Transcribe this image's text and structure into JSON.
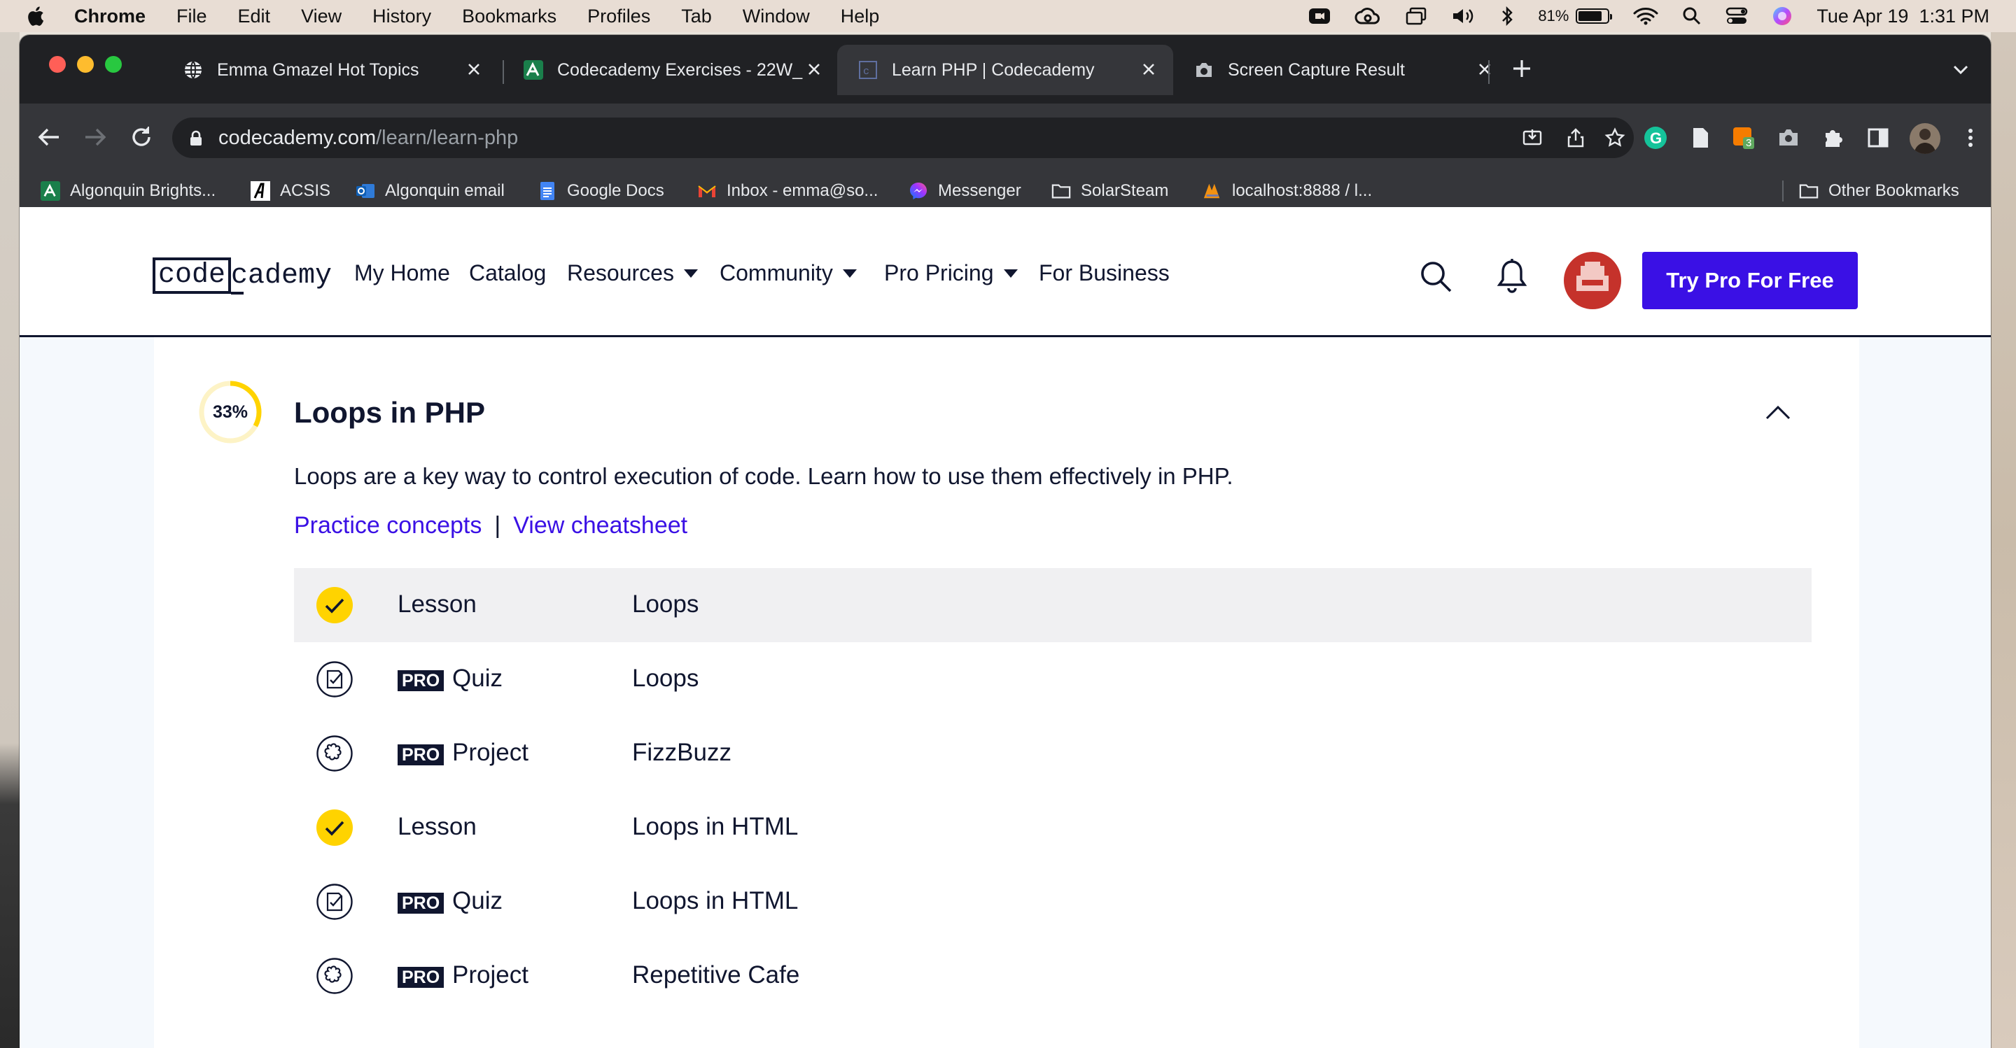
{
  "menubar": {
    "app_name": "Chrome",
    "items": [
      "File",
      "Edit",
      "View",
      "History",
      "Bookmarks",
      "Profiles",
      "Tab",
      "Window",
      "Help"
    ],
    "battery_percent": "81%",
    "battery_level": 0.81,
    "datetime": "Tue Apr 19  1:31 PM"
  },
  "tabs": [
    {
      "title": "Emma Gmazel Hot Topics",
      "icon": "globe-icon",
      "active": false
    },
    {
      "title": "Codecademy Exercises - 22W_",
      "icon": "algonquin-icon",
      "active": false
    },
    {
      "title": "Learn PHP | Codecademy",
      "icon": "codecademy-icon",
      "active": true
    },
    {
      "title": "Screen Capture Result",
      "icon": "camera-icon",
      "active": false
    }
  ],
  "address_bar": {
    "domain": "codecademy.com",
    "path": "/learn/learn-php"
  },
  "bookmarks": [
    {
      "label": "Algonquin Brights...",
      "icon": "algonquin-icon"
    },
    {
      "label": "ACSIS",
      "icon": "acsis-icon"
    },
    {
      "label": "Algonquin email",
      "icon": "outlook-icon"
    },
    {
      "label": "Google Docs",
      "icon": "docs-icon"
    },
    {
      "label": "Inbox - emma@so...",
      "icon": "gmail-icon"
    },
    {
      "label": "Messenger",
      "icon": "messenger-icon"
    },
    {
      "label": "SolarSteam",
      "icon": "folder-icon"
    },
    {
      "label": "localhost:8888 / l...",
      "icon": "phpmyadmin-icon"
    }
  ],
  "other_bookmarks": "Other Bookmarks",
  "extension_badge": "3",
  "site": {
    "logo_boxed": "code",
    "logo_rest": "cademy",
    "nav": [
      {
        "label": "My Home",
        "dropdown": false
      },
      {
        "label": "Catalog",
        "dropdown": false
      },
      {
        "label": "Resources",
        "dropdown": true
      },
      {
        "label": "Community",
        "dropdown": true
      },
      {
        "label": "Pro Pricing",
        "dropdown": true
      },
      {
        "label": "For Business",
        "dropdown": false
      }
    ],
    "cta": "Try Pro For Free",
    "accent_color": "#3a10e5",
    "navy_color": "#10162f",
    "check_color": "#ffd300"
  },
  "section": {
    "progress_label": "33%",
    "progress_fraction": 0.33,
    "title": "Loops in PHP",
    "description": "Loops are a key way to control execution of code. Learn how to use them effectively in PHP.",
    "link_practice": "Practice concepts",
    "link_separator": "|",
    "link_cheatsheet": "View cheatsheet",
    "pro_badge": "PRO",
    "items": [
      {
        "kind": "Lesson",
        "name": "Loops",
        "pro": false,
        "completed": true,
        "icon": "check-icon"
      },
      {
        "kind": "Quiz",
        "name": "Loops",
        "pro": true,
        "completed": false,
        "icon": "quiz-icon"
      },
      {
        "kind": "Project",
        "name": "FizzBuzz",
        "pro": true,
        "completed": false,
        "icon": "puzzle-icon"
      },
      {
        "kind": "Lesson",
        "name": "Loops in HTML",
        "pro": false,
        "completed": true,
        "icon": "check-icon"
      },
      {
        "kind": "Quiz",
        "name": "Loops in HTML",
        "pro": true,
        "completed": false,
        "icon": "quiz-icon"
      },
      {
        "kind": "Project",
        "name": "Repetitive Cafe",
        "pro": true,
        "completed": false,
        "icon": "puzzle-icon"
      }
    ]
  }
}
